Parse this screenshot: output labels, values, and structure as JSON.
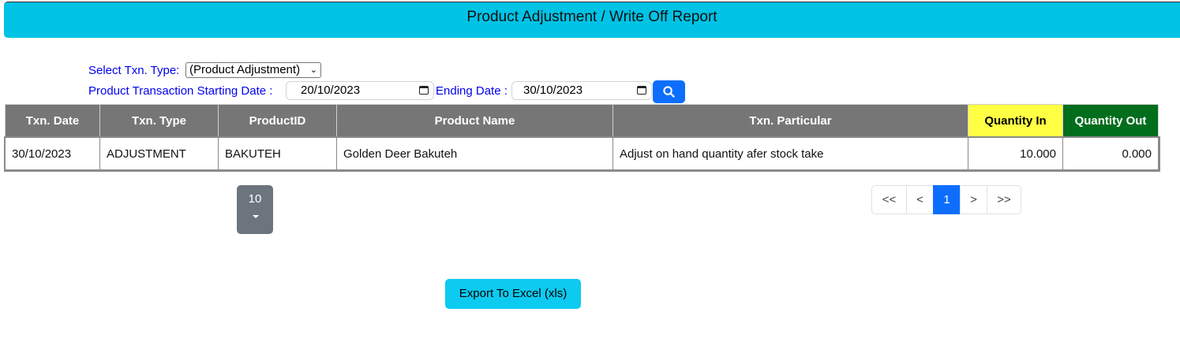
{
  "header": {
    "title": "Product Adjustment / Write Off Report"
  },
  "filters": {
    "txn_type_label": "Select Txn. Type:",
    "txn_type_value": "(Product Adjustment)",
    "start_label": "Product Transaction Starting Date :",
    "start_value": "20/10/2023",
    "end_label": "Ending Date :",
    "end_value": "30/10/2023"
  },
  "table": {
    "headers": {
      "txn_date": "Txn. Date",
      "txn_type": "Txn. Type",
      "product_id": "ProductID",
      "product_name": "Product Name",
      "txn_particular": "Txn. Particular",
      "qty_in": "Quantity In",
      "qty_out": "Quantity Out"
    },
    "rows": [
      {
        "txn_date": "30/10/2023",
        "txn_type": "ADJUSTMENT",
        "product_id": "BAKUTEH",
        "product_name": "Golden Deer Bakuteh",
        "txn_particular": "Adjust on hand quantity afer stock take",
        "qty_in": "10.000",
        "qty_out": "0.000"
      }
    ]
  },
  "pagination": {
    "page_size": "10",
    "first": "<<",
    "prev": "<",
    "current": "1",
    "next": ">",
    "last": ">>"
  },
  "export": {
    "label": "Export To Excel (xls)"
  },
  "colors": {
    "header_bar": "#00c3e6",
    "qty_in_header": "#ffff44",
    "qty_out_header": "#006e1c",
    "primary": "#0d6efd"
  },
  "icons": {
    "search": "search-icon",
    "calendar": "calendar-icon",
    "caret": "caret-down-icon"
  }
}
